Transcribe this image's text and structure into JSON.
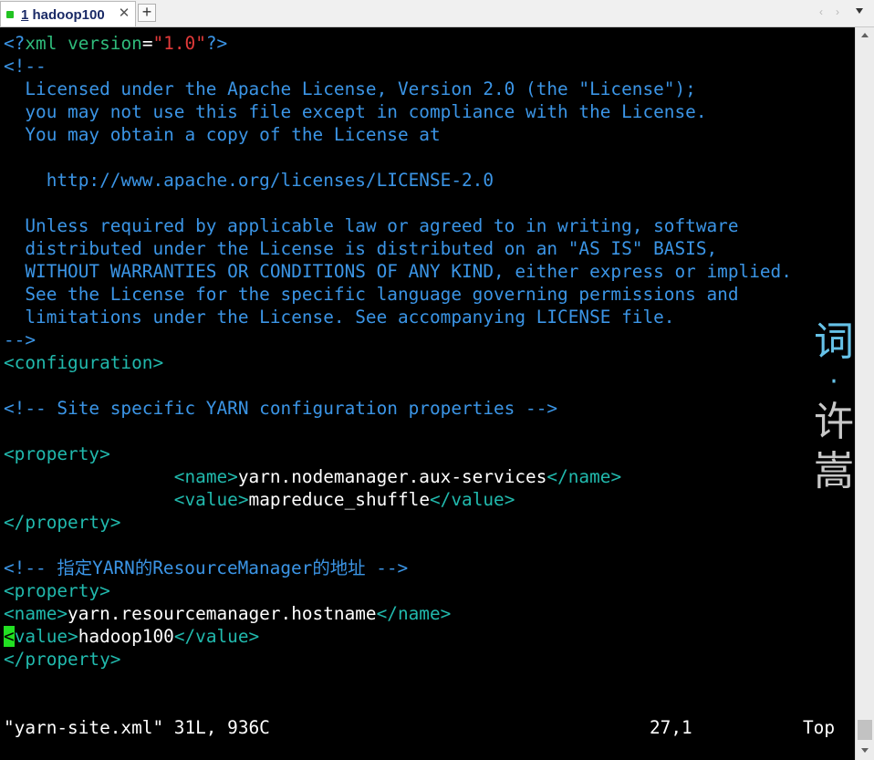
{
  "tab": {
    "number": "1",
    "title": "hadoop100",
    "close": "✕",
    "add": "+"
  },
  "tab_nav": {
    "left": "‹",
    "right": "›"
  },
  "editor": {
    "xml_decl": {
      "open": "<?",
      "tag": "xml",
      "attr": "version",
      "eq": "=",
      "value": "\"1.0\"",
      "close": "?>"
    },
    "license_lines": [
      "<!--",
      "  Licensed under the Apache License, Version 2.0 (the \"License\");",
      "  you may not use this file except in compliance with the License.",
      "  You may obtain a copy of the License at",
      "",
      "    http://www.apache.org/licenses/LICENSE-2.0",
      "",
      "  Unless required by applicable law or agreed to in writing, software",
      "  distributed under the License is distributed on an \"AS IS\" BASIS,",
      "  WITHOUT WARRANTIES OR CONDITIONS OF ANY KIND, either express or implied.",
      "  See the License for the specific language governing permissions and",
      "  limitations under the License. See accompanying LICENSE file.",
      "-->"
    ],
    "configuration_open": "<configuration>",
    "comment_site": "<!-- Site specific YARN configuration properties -->",
    "property_open": "<property>",
    "property_close": "</property>",
    "prop1": {
      "indent": "                ",
      "name_open": "<name>",
      "name_value": "yarn.nodemanager.aux-services",
      "name_close": "</name>",
      "value_open": "<value>",
      "value_value": "mapreduce_shuffle",
      "value_close": "</value>"
    },
    "comment_rm": "<!-- 指定YARN的ResourceManager的地址 -->",
    "prop2": {
      "name_open": "<name>",
      "name_value": "yarn.resourcemanager.hostname",
      "name_close": "</name>",
      "value_cursor": "<",
      "value_open_rest": "value>",
      "value_value": "hadoop100",
      "value_close": "</value>"
    }
  },
  "status": {
    "file": "\"yarn-site.xml\" 31L, 936C",
    "position": "27,1",
    "scroll": "Top"
  },
  "watermark": {
    "line1": "词",
    "sep": "·",
    "line2": "许",
    "line3": "嵩"
  },
  "colors": {
    "comment": "#3b95e6",
    "tag": "#2fbb7b",
    "string": "#e23a3a",
    "element": "#21b9ad",
    "cursor": "#22e022"
  }
}
